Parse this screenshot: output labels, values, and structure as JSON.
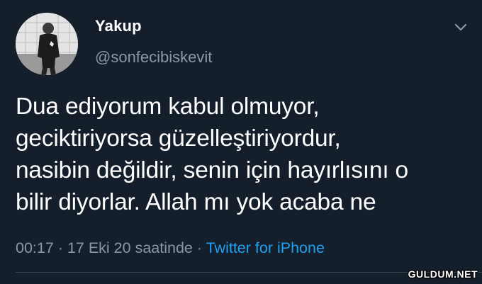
{
  "tweet": {
    "display_name": "Yakup",
    "handle": "@sonfecibiskevit",
    "text_lines": [
      "Dua ediyorum kabul olmuyor,",
      "geciktiriyorsa güzelleştiriyordur,",
      "nasibin değildir, senin için hayırlısını o",
      "bilir diyorlar. Allah mı yok acaba ne"
    ],
    "time": "00:17",
    "separator": "·",
    "date": "17 Eki 20 saatinde",
    "source": "Twitter for iPhone"
  },
  "watermark": "GULDUM.NET",
  "colors": {
    "background": "#151e2b",
    "text": "#ffffff",
    "secondary": "#8899a6",
    "link": "#1da1f2"
  },
  "icons": {
    "menu": "chevron-down-icon"
  }
}
